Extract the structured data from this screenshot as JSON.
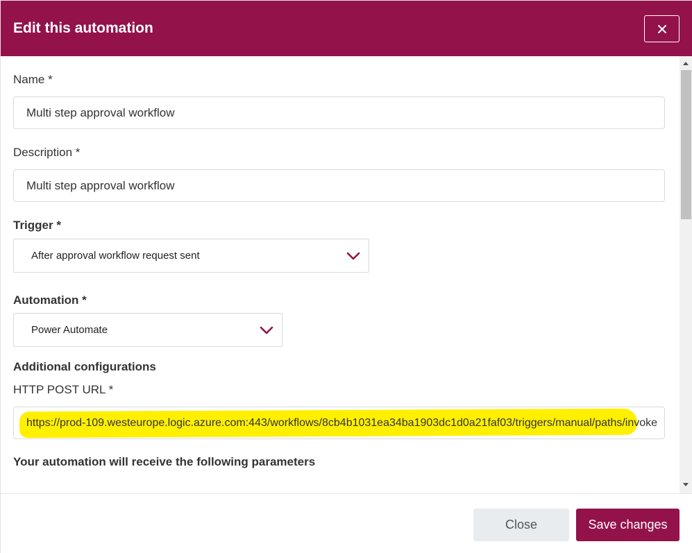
{
  "dialog": {
    "title": "Edit this automation",
    "close_icon": "close-icon"
  },
  "form": {
    "name": {
      "label": "Name *",
      "value": "Multi step approval workflow"
    },
    "description": {
      "label": "Description *",
      "value": "Multi step approval workflow"
    },
    "trigger": {
      "label": "Trigger *",
      "selected": "After approval workflow request sent",
      "icon": "chevron-down-icon"
    },
    "automation": {
      "label": "Automation *",
      "selected": "Power Automate",
      "icon": "chevron-down-icon"
    },
    "additional_heading": "Additional configurations",
    "http_post_url": {
      "label": "HTTP POST URL *",
      "value": "https://prod-109.westeurope.logic.azure.com:443/workflows/8cb4b1031ea34ba1903dc1d0a21faf03/triggers/manual/paths/invoke"
    },
    "parameters_heading": "Your automation will receive the following parameters"
  },
  "footer": {
    "close_label": "Close",
    "save_label": "Save changes"
  },
  "colors": {
    "brand": "#93124a",
    "highlight": "#ffef00",
    "secondary_button": "#e9ecef"
  }
}
